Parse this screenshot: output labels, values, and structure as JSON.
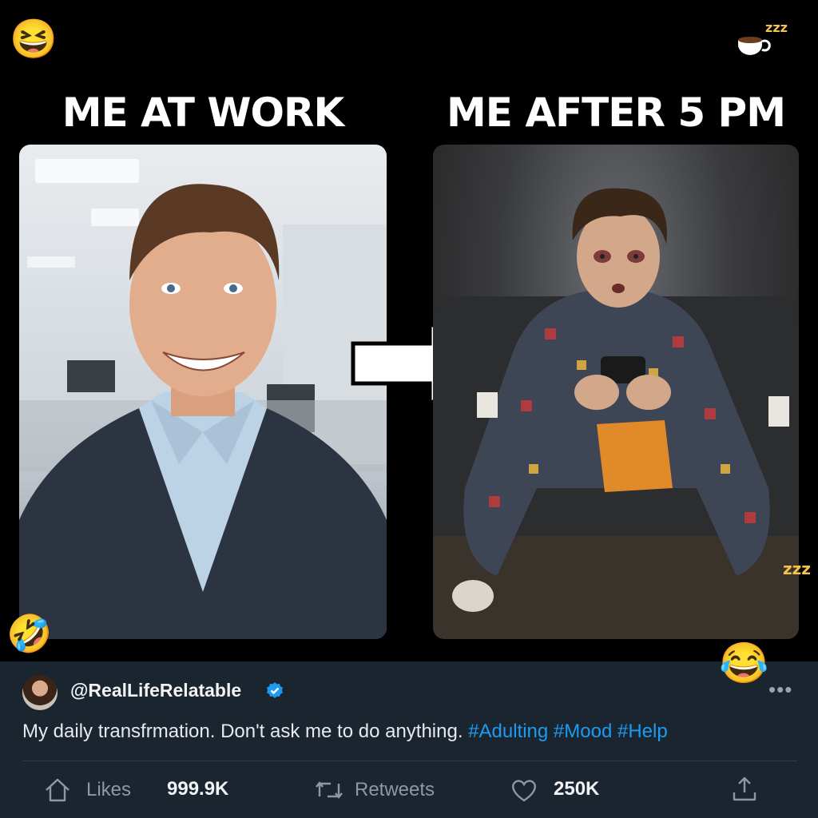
{
  "meme": {
    "caption_left": "ME AT WORK",
    "caption_right": "ME AFTER 5 PM",
    "emojis": {
      "top_left": "😆",
      "top_right_sleep": "zzz",
      "bottom_left": "🤣",
      "right_sleep": "zzz",
      "bottom_right": "😂"
    }
  },
  "post": {
    "handle": "@RealLifeRelatable",
    "text": "My daily transfrmation. Don't ask me to do anything.",
    "hashtags": "#Adulting #Mood #Help",
    "more_label": "•••",
    "actions": {
      "likes_label": "Likes",
      "likes_count": "999.9K",
      "retweets_label": "Retweets",
      "heart_count": "250K"
    }
  },
  "colors": {
    "link": "#1d9bf0",
    "post_bg": "#1b2530",
    "meme_bg": "#000000"
  }
}
